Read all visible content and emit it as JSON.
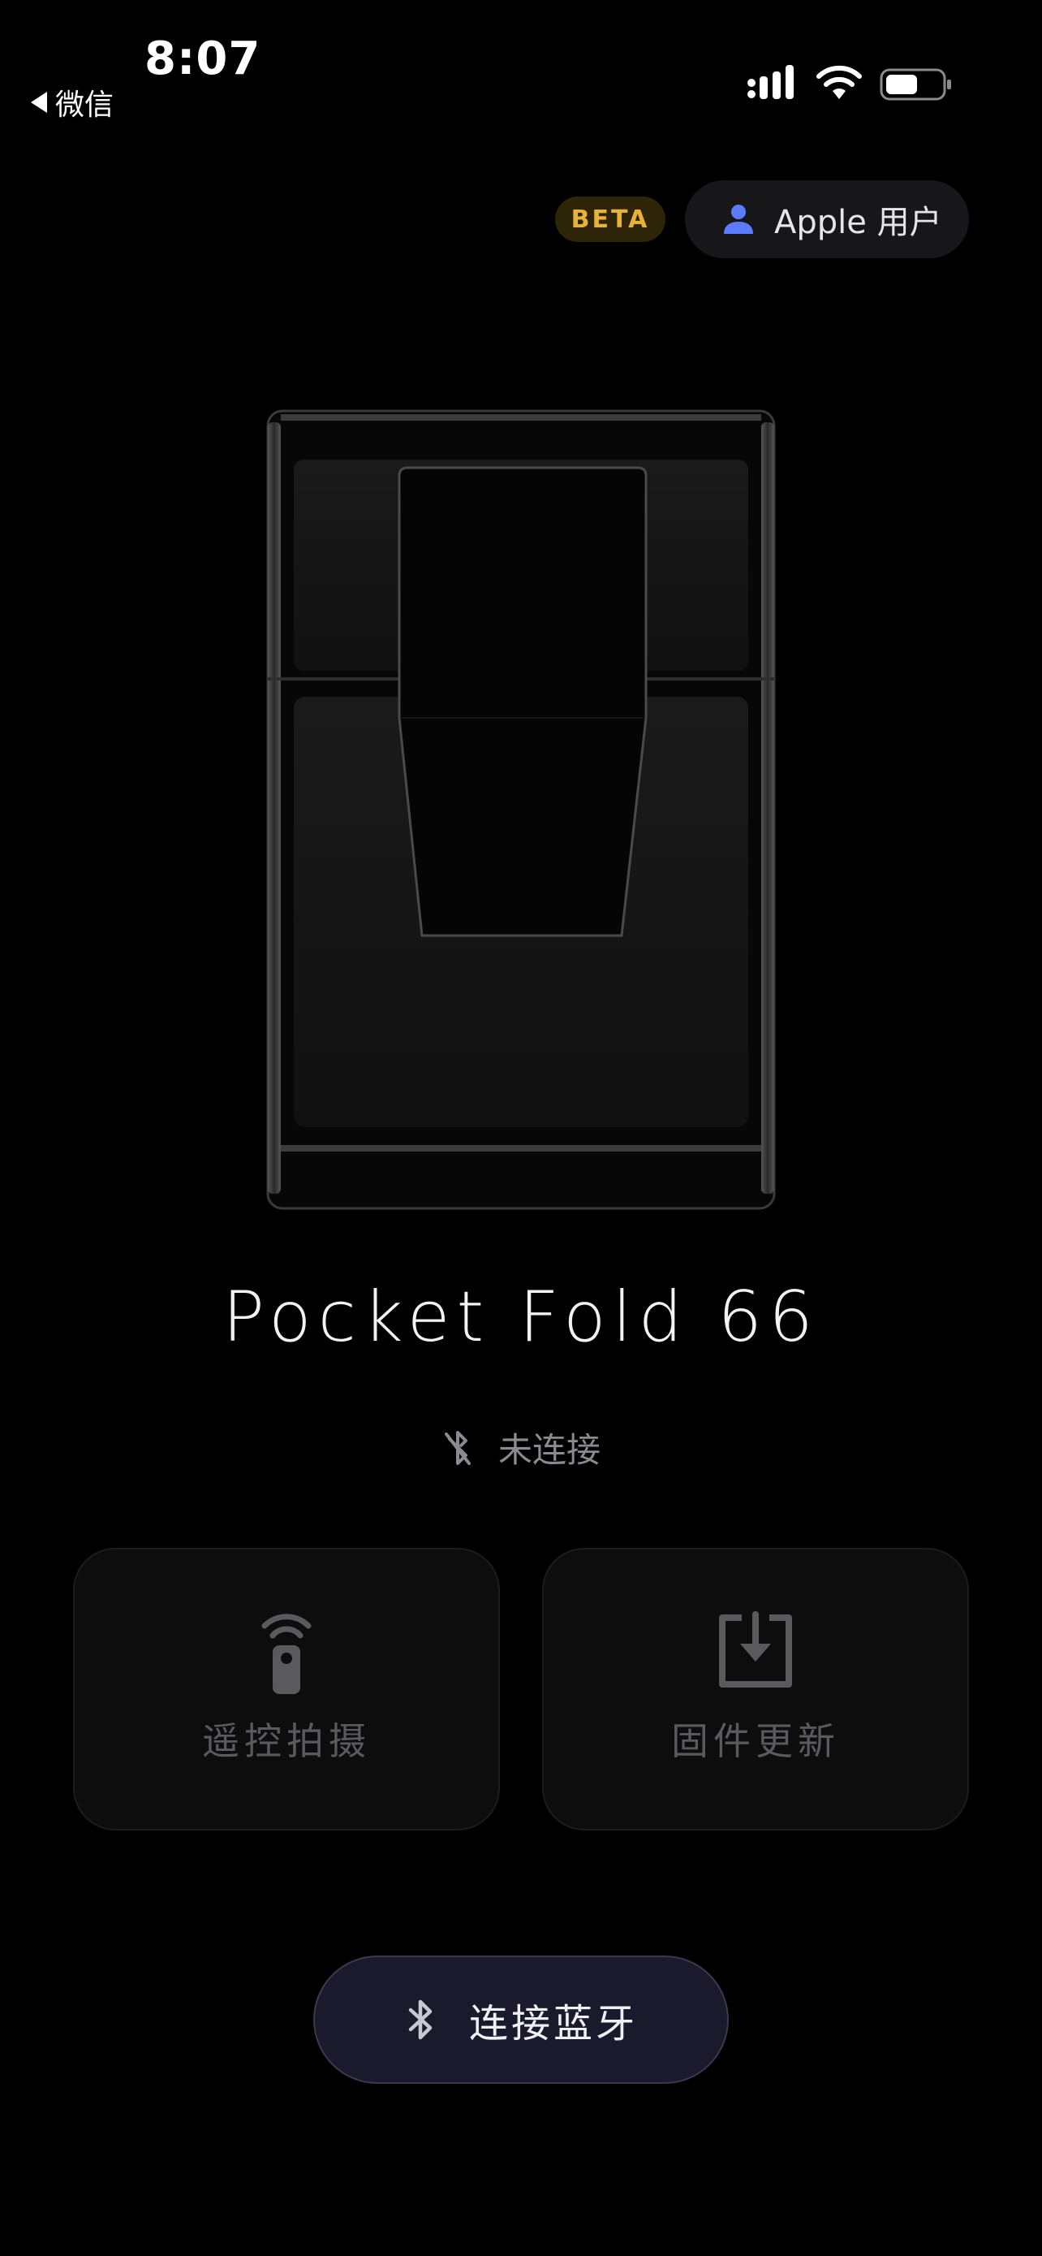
{
  "status_bar": {
    "time": "8:07",
    "back_label": "微信",
    "icons": [
      "cellular-signal-icon",
      "wifi-icon",
      "battery-icon"
    ]
  },
  "header": {
    "beta_badge": "BETA",
    "user_label": "Apple 用户",
    "user_icon": "person-icon"
  },
  "device": {
    "name": "Pocket Fold 66",
    "connection_status": "未连接",
    "status_icon": "bluetooth-disconnected-icon"
  },
  "cards": [
    {
      "label": "遥控拍摄",
      "icon": "remote-control-icon"
    },
    {
      "label": "固件更新",
      "icon": "firmware-download-icon"
    }
  ],
  "connect_button": {
    "label": "连接蓝牙",
    "icon": "bluetooth-icon"
  },
  "colors": {
    "background": "#000000",
    "beta_text": "#e8b23a",
    "user_icon": "#5b7cff",
    "connect_bg": "#1a1a2c",
    "card_bg": "#0d0d0d"
  }
}
